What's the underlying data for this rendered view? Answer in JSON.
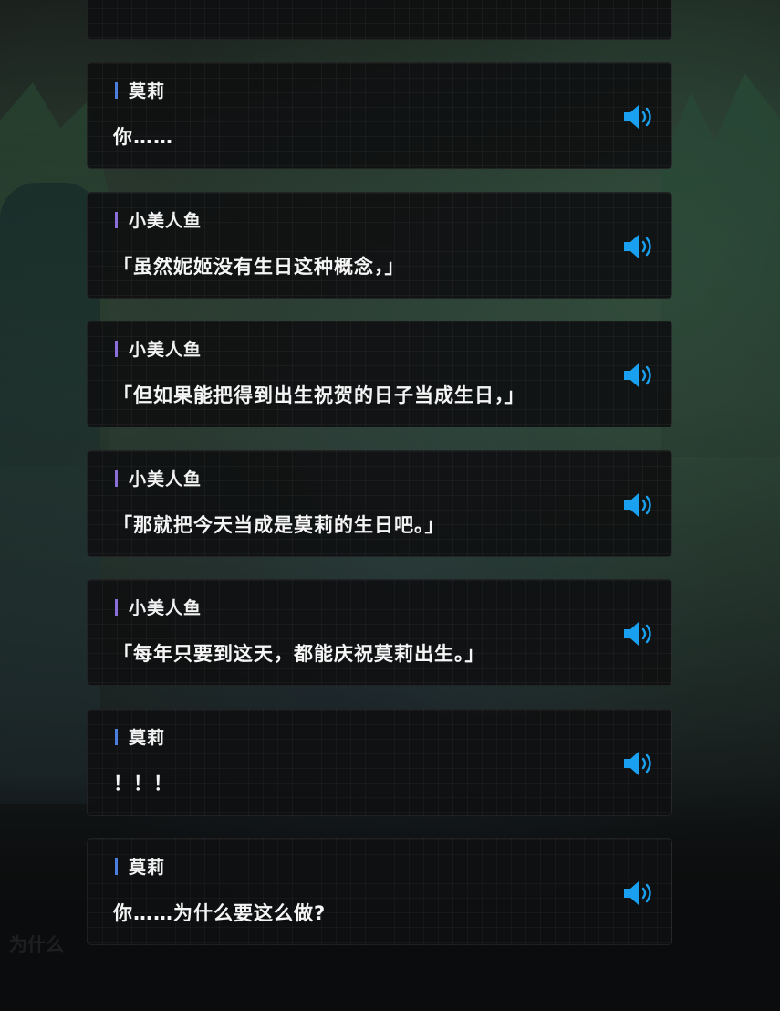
{
  "accent": {
    "mary": "#4a7fe0",
    "mermaid": "#8a6fd8",
    "voice_icon": "#1aa0f0"
  },
  "background_ghost_text": "为什么",
  "dialogue": [
    {
      "speaker": "莫莉",
      "speaker_id": "mary",
      "text": "你……"
    },
    {
      "speaker": "小美人鱼",
      "speaker_id": "mermaid",
      "text": "「虽然妮姬没有生日这种概念，」"
    },
    {
      "speaker": "小美人鱼",
      "speaker_id": "mermaid",
      "text": "「但如果能把得到出生祝贺的日子当成生日，」"
    },
    {
      "speaker": "小美人鱼",
      "speaker_id": "mermaid",
      "text": "「那就把今天当成是莫莉的生日吧。」"
    },
    {
      "speaker": "小美人鱼",
      "speaker_id": "mermaid",
      "text": "「每年只要到这天，都能庆祝莫莉出生。」"
    },
    {
      "speaker": "莫莉",
      "speaker_id": "mary",
      "text": "！！！"
    },
    {
      "speaker": "莫莉",
      "speaker_id": "mary",
      "text": "你……为什么要这么做?"
    }
  ],
  "voice_icon": "speaker-volume-icon"
}
